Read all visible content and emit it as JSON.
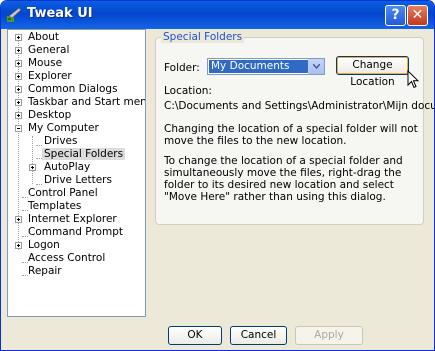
{
  "window": {
    "title": "Tweak UI",
    "help_glyph": "?",
    "close_glyph": "✕"
  },
  "tree": {
    "items": [
      {
        "label": "About",
        "expander": "plus"
      },
      {
        "label": "General",
        "expander": "plus"
      },
      {
        "label": "Mouse",
        "expander": "plus"
      },
      {
        "label": "Explorer",
        "expander": "plus"
      },
      {
        "label": "Common Dialogs",
        "expander": "plus"
      },
      {
        "label": "Taskbar and Start menu",
        "expander": "plus"
      },
      {
        "label": "Desktop",
        "expander": "plus"
      },
      {
        "label": "My Computer",
        "expander": "minus"
      },
      {
        "label": "Drives",
        "expander": "none"
      },
      {
        "label": "Special Folders",
        "expander": "none",
        "selected": true
      },
      {
        "label": "AutoPlay",
        "expander": "plus"
      },
      {
        "label": "Drive Letters",
        "expander": "none"
      },
      {
        "label": "Control Panel",
        "expander": "none"
      },
      {
        "label": "Templates",
        "expander": "none"
      },
      {
        "label": "Internet Explorer",
        "expander": "plus"
      },
      {
        "label": "Command Prompt",
        "expander": "none"
      },
      {
        "label": "Logon",
        "expander": "plus"
      },
      {
        "label": "Access Control",
        "expander": "none"
      },
      {
        "label": "Repair",
        "expander": "none"
      }
    ]
  },
  "special_folders": {
    "group_title": "Special Folders",
    "folder_label": "Folder:",
    "folder_value": "My Documents",
    "change_button": "Change Location",
    "location_label": "Location:",
    "location_path": "C:\\Documents and Settings\\Administrator\\Mijn documenten",
    "note_1": "Changing the location of a special folder will not move the files to the new location.",
    "note_2": "To change the location of a special folder and simultaneously move the files, right-drag the folder to its desired new location and select \"Move Here\" rather than using this dialog."
  },
  "buttons": {
    "ok": "OK",
    "cancel": "Cancel",
    "apply": "Apply"
  },
  "colors": {
    "titlebar": "#0446cf",
    "selection": "#316ac5",
    "group_title": "#1f4fd0"
  }
}
